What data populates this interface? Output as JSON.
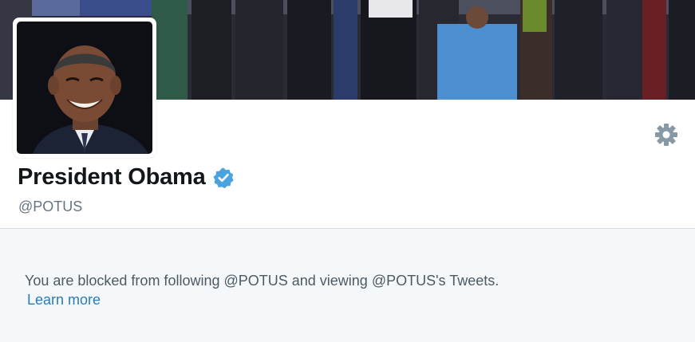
{
  "profile": {
    "display_name": "President Obama",
    "handle": "@POTUS",
    "verified": true
  },
  "blocked_notice": {
    "message": "You are blocked from following @POTUS and viewing @POTUS's Tweets.",
    "learn_more_label": "Learn more"
  },
  "icons": {
    "settings": "gear-icon",
    "verified": "verified-badge-icon"
  },
  "colors": {
    "verified_badge": "#4aa3df",
    "link": "#2b7bb9",
    "name_text": "#14171a",
    "secondary_text": "#66757f",
    "page_background": "#f5f8fa"
  }
}
